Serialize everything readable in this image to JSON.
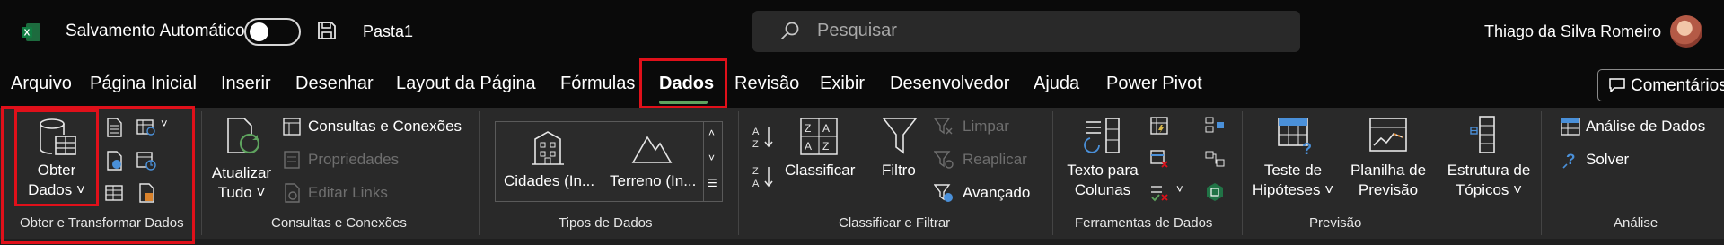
{
  "titlebar": {
    "autosave_label": "Salvamento Automático",
    "filename": "Pasta1",
    "search_placeholder": "Pesquisar",
    "username": "Thiago da Silva Romeiro"
  },
  "tabs": [
    "Arquivo",
    "Página Inicial",
    "Inserir",
    "Desenhar",
    "Layout da Página",
    "Fórmulas",
    "Dados",
    "Revisão",
    "Exibir",
    "Desenvolvedor",
    "Ajuda",
    "Power Pivot"
  ],
  "active_tab": "Dados",
  "comments_label": "Comentários",
  "groups": {
    "obter": {
      "label": "Obter e Transformar Dados",
      "obter_line1": "Obter",
      "obter_line2": "Dados"
    },
    "consultas": {
      "label": "Consultas e Conexões",
      "atualizar_line1": "Atualizar",
      "atualizar_line2": "Tudo",
      "consultas_conexoes": "Consultas e Conexões",
      "propriedades": "Propriedades",
      "editar_links": "Editar Links"
    },
    "tipos": {
      "label": "Tipos de Dados",
      "cidades": "Cidades (In...",
      "terreno": "Terreno (In..."
    },
    "classificar": {
      "label": "Classificar e Filtrar",
      "classificar": "Classificar",
      "filtro": "Filtro",
      "limpar": "Limpar",
      "reaplicar": "Reaplicar",
      "avancado": "Avançado"
    },
    "ferramentas": {
      "label": "Ferramentas de Dados",
      "texto_line1": "Texto para",
      "texto_line2": "Colunas"
    },
    "previsao": {
      "label": "Previsão",
      "teste_line1": "Teste de",
      "teste_line2": "Hipóteses",
      "planilha_line1": "Planilha de",
      "planilha_line2": "Previsão"
    },
    "estrutura": {
      "estrutura_line1": "Estrutura de",
      "estrutura_line2": "Tópicos"
    },
    "analise": {
      "label": "Análise",
      "analise_dados": "Análise de Dados",
      "solver": "Solver"
    }
  },
  "colors": {
    "accent_red": "#e0101a",
    "tab_underline": "#5ea35e",
    "excel_green": "#217346",
    "blue_icon": "#4a90d9"
  }
}
